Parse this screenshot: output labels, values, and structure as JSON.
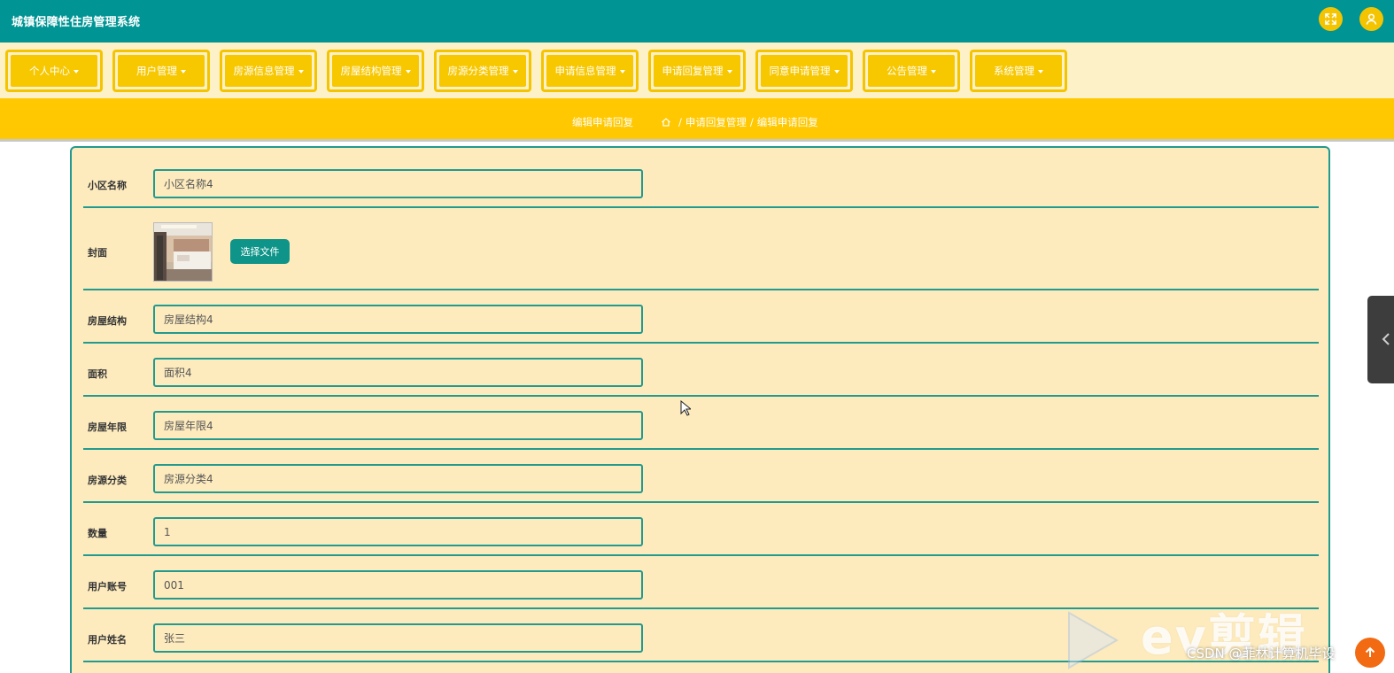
{
  "header": {
    "app_title": "城镇保障性住房管理系统",
    "fullscreen_icon": "expand-icon",
    "user_icon": "user-icon"
  },
  "nav": {
    "items": [
      {
        "label": "个人中心"
      },
      {
        "label": "用户管理"
      },
      {
        "label": "房源信息管理"
      },
      {
        "label": "房屋结构管理"
      },
      {
        "label": "房源分类管理"
      },
      {
        "label": "申请信息管理"
      },
      {
        "label": "申请回复管理"
      },
      {
        "label": "同意申请管理"
      },
      {
        "label": "公告管理"
      },
      {
        "label": "系统管理"
      }
    ]
  },
  "breadcrumb": {
    "title": "编辑申请回复",
    "home_icon": "home-icon",
    "separator": "/",
    "parent": "申请回复管理",
    "current": "编辑申请回复"
  },
  "form": {
    "community_name": {
      "label": "小区名称",
      "value": "小区名称4"
    },
    "cover": {
      "label": "封面",
      "button_label": "选择文件"
    },
    "house_structure": {
      "label": "房屋结构",
      "value": "房屋结构4"
    },
    "area": {
      "label": "面积",
      "value": "面积4"
    },
    "house_age": {
      "label": "房屋年限",
      "value": "房屋年限4"
    },
    "house_category": {
      "label": "房源分类",
      "value": "房源分类4"
    },
    "quantity": {
      "label": "数量",
      "value": "1"
    },
    "user_account": {
      "label": "用户账号",
      "value": "001"
    },
    "user_name": {
      "label": "用户姓名",
      "value": "张三"
    }
  },
  "watermark": {
    "brand": "ev剪辑",
    "credit": "CSDN @菲林计算机毕设"
  },
  "colors": {
    "header_bg": "#009494",
    "nav_bg": "#fdf1c7",
    "accent_yellow": "#f7c700",
    "crumb_bg": "#ffc800",
    "panel_bg": "#fdebbe",
    "border_teal": "#229a8e",
    "button_teal": "#0e9488"
  }
}
